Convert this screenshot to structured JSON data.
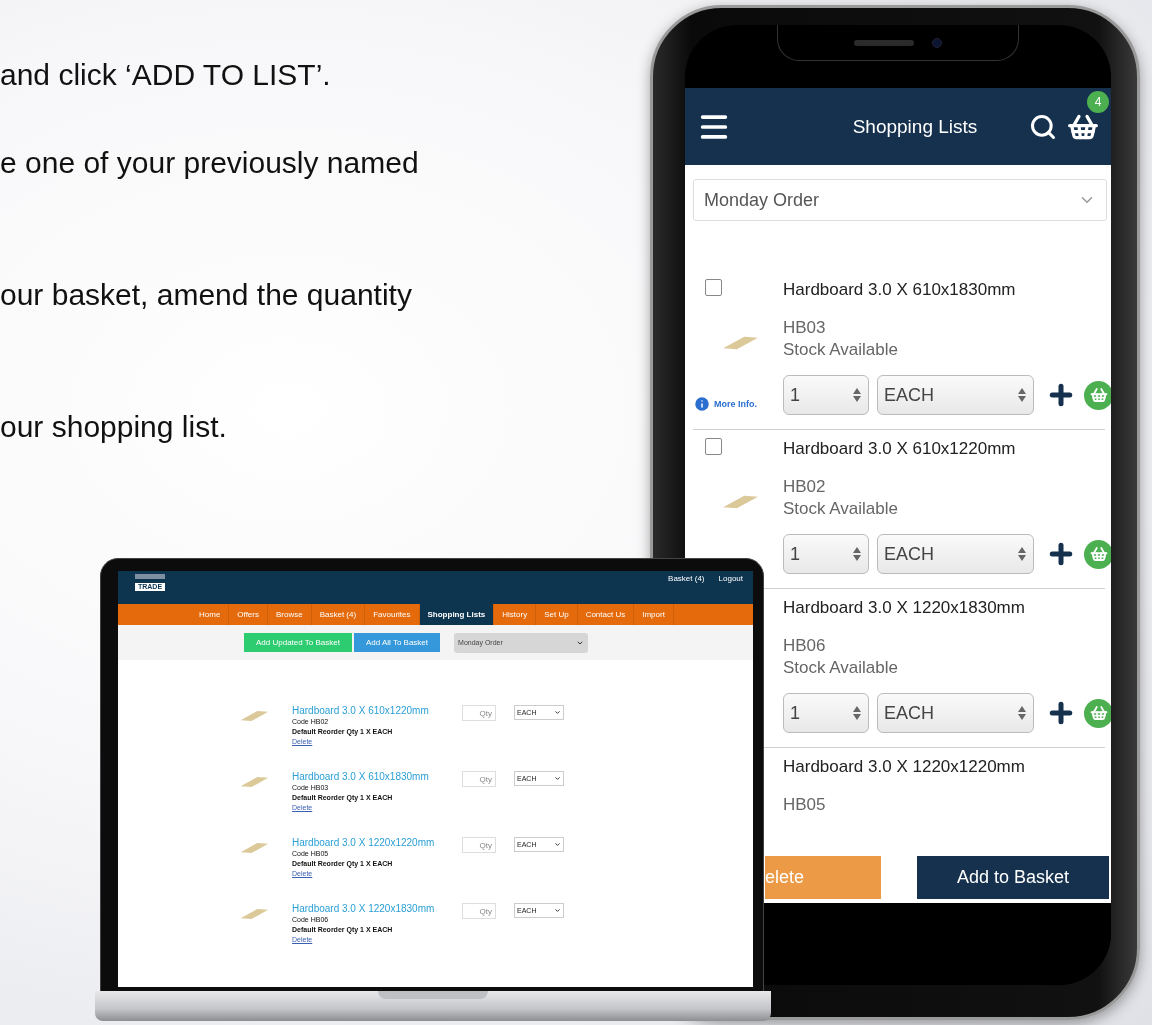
{
  "slide_text": [
    "and click ‘ADD TO LIST’.",
    "e one of your previously named",
    "our basket, amend the quantity",
    "our shopping list."
  ],
  "laptop": {
    "logo_text": "TRADE",
    "header_links": [
      "Basket (4)",
      "Logout"
    ],
    "nav": [
      {
        "label": "Home",
        "selected": false
      },
      {
        "label": "Offers",
        "selected": false
      },
      {
        "label": "Browse",
        "selected": false
      },
      {
        "label": "Basket (4)",
        "selected": false
      },
      {
        "label": "Favourites",
        "selected": false
      },
      {
        "label": "Shopping Lists",
        "selected": true
      },
      {
        "label": "History",
        "selected": false
      },
      {
        "label": "Set Up",
        "selected": false
      },
      {
        "label": "Contact Us",
        "selected": false
      },
      {
        "label": "Import",
        "selected": false
      }
    ],
    "toolbar": {
      "buttons": [
        {
          "label": "Add Updated To Basket",
          "kind": "green"
        },
        {
          "label": "Add All To Basket",
          "kind": "blue"
        }
      ],
      "list_select": "Monday Order"
    },
    "items": [
      {
        "name": "Hardboard 3.0 X 610x1220mm",
        "code": "Code  HB02",
        "reorder": "Default Reorder Qty 1 X EACH",
        "delete": "Delete",
        "qty_placeholder": "Qty",
        "unit": "EACH"
      },
      {
        "name": "Hardboard 3.0 X 610x1830mm",
        "code": "Code  HB03",
        "reorder": "Default Reorder Qty 1 X EACH",
        "delete": "Delete",
        "qty_placeholder": "Qty",
        "unit": "EACH"
      },
      {
        "name": "Hardboard 3.0 X 1220x1220mm",
        "code": "Code  HB05",
        "reorder": "Default Reorder Qty 1 X EACH",
        "delete": "Delete",
        "qty_placeholder": "Qty",
        "unit": "EACH"
      },
      {
        "name": "Hardboard 3.0 X 1220x1830mm",
        "code": "Code  HB06",
        "reorder": "Default Reorder Qty 1 X EACH",
        "delete": "Delete",
        "qty_placeholder": "Qty",
        "unit": "EACH"
      }
    ]
  },
  "phone": {
    "title": "Shopping Lists",
    "basket_count": "4",
    "list_select": "Monday Order",
    "items": [
      {
        "checked": false,
        "image": true,
        "name": "Hardboard 3.0 X 610x1830mm",
        "code": "HB03",
        "stock": "Stock Available",
        "qty": "1",
        "unit": "EACH",
        "more_info": "More Info."
      },
      {
        "checked": false,
        "image": true,
        "name": "Hardboard 3.0 X 610x1220mm",
        "code": "HB02",
        "stock": "Stock Available",
        "qty": "1",
        "unit": "EACH"
      },
      {
        "name": "Hardboard 3.0 X 1220x1830mm",
        "code": "HB06",
        "stock": "Stock Available",
        "qty": "1",
        "unit": "EACH"
      },
      {
        "name": "Hardboard 3.0 X 1220x1220mm",
        "code": "HB05"
      }
    ],
    "buttons": [
      {
        "label": "elete",
        "kind": "delete"
      },
      {
        "label": "Add to Basket",
        "kind": "primary"
      }
    ]
  }
}
